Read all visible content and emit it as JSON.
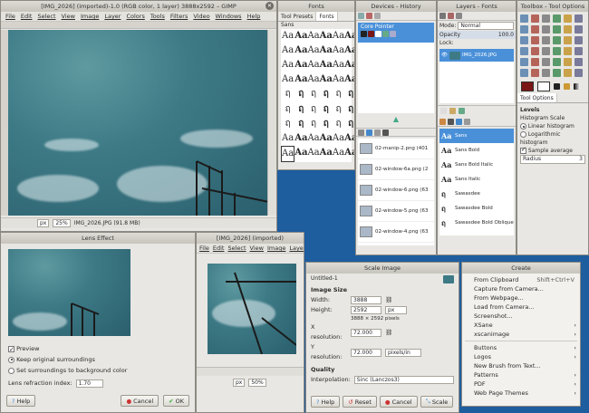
{
  "gimp": {
    "title": "[IMG_2026] (imported)-1.0 (RGB color, 1 layer) 3888x2592 – GIMP",
    "menu": [
      "File",
      "Edit",
      "Select",
      "View",
      "Image",
      "Layer",
      "Colors",
      "Tools",
      "Filters",
      "Video",
      "Windows",
      "Help"
    ],
    "status_unit": "px",
    "zoom": "25%",
    "filename": "IMG_2026.JPG (91.8 MB)"
  },
  "fonts_dock": {
    "title": "Fonts",
    "tabs": [
      "Tool Presets",
      "Fonts"
    ],
    "header": "Sans",
    "glyph_rows": [
      [
        "Aa",
        "Aa",
        "Aa",
        "Aa",
        "Aa",
        "Aa"
      ],
      [
        "Aa",
        "Aa",
        "Aa",
        "Aa",
        "Aa",
        "Aa"
      ],
      [
        "Aa",
        "Aa",
        "Aa",
        "Aa",
        "Aa",
        "Aa"
      ],
      [
        "Aa",
        "Aa",
        "Aa",
        "Aa",
        "Aa",
        "Aa"
      ],
      [
        "ฤ",
        "ฤ",
        "ฤ",
        "ฤ",
        "ฤ",
        "ฤ"
      ],
      [
        "ฤ",
        "ฤ",
        "ฤ",
        "ฤ",
        "ฤ",
        "ฤ"
      ],
      [
        "ฤ",
        "ฤ",
        "ฤ",
        "ฤ",
        "ฤ",
        "ฤ"
      ],
      [
        "Aa",
        "Aa",
        "Aa",
        "Aa",
        "Aa",
        "Aa"
      ],
      [
        "Aa",
        "Aa",
        "Aa",
        "Aa",
        "Aa",
        "Aa"
      ]
    ]
  },
  "devices_dock": {
    "title": "Devices - History",
    "device": "Core Pointer",
    "history": [
      "02-manip-2.png (401",
      "02-window-6a.png (2",
      "02-window-6.png (63",
      "02-window-5.png (63",
      "02-window-4.png (63"
    ]
  },
  "layers_dock": {
    "title": "Layers - Fonts",
    "mode_label": "Mode:",
    "mode_value": "Normal",
    "opacity_label": "Opacity",
    "opacity_value": "100.0",
    "lock_label": "Lock:",
    "layer_name": "IMG_2026.JPG",
    "fonts": [
      "Sans",
      "Sans Bold",
      "Sans Bold Italic",
      "Sans Italic",
      "Sawasdee",
      "Sawasdee Bold",
      "Sawasdee Bold Oblique"
    ]
  },
  "toolbox": {
    "title": "Toolbox - Tool Options",
    "tab": "Tool Options",
    "levels_label": "Levels",
    "histogram_label": "Histogram Scale",
    "linear": "Linear histogram",
    "log": "Logarithmic histogram",
    "sample_average": "Sample average",
    "radius_label": "Radius",
    "radius_value": "3",
    "colors": {
      "fg": "#7a1616",
      "bg": "#ffffff"
    }
  },
  "lens": {
    "title": "Lens Effect",
    "preview": "Preview",
    "keep": "Keep original surroundings",
    "set_bg": "Set surroundings to background color",
    "refraction_label": "Lens refraction index:",
    "refraction_value": "1.70",
    "help": "Help",
    "cancel": "Cancel",
    "ok": "OK"
  },
  "gimp2": {
    "title": "[IMG_2026] (imported)",
    "menu": [
      "File",
      "Edit",
      "Select",
      "View",
      "Image",
      "Layer"
    ],
    "unit": "px",
    "zoom": "50%"
  },
  "scale": {
    "title": "Scale Image",
    "subtitle": "Untitled-1",
    "image_size": "Image Size",
    "width_label": "Width:",
    "width_value": "3888",
    "height_label": "Height:",
    "height_value": "2592",
    "pixels_info": "3888 × 2592 pixels",
    "unit": "px",
    "xres_label": "X resolution:",
    "xres_value": "72.000",
    "yres_label": "Y resolution:",
    "yres_value": "72.000",
    "res_unit": "pixels/in",
    "quality": "Quality",
    "interp_label": "Interpolation:",
    "interp_value": "Sinc (Lanczos3)",
    "help": "Help",
    "reset": "Reset",
    "cancel": "Cancel",
    "scale": "Scale"
  },
  "create": {
    "title": "Create",
    "items": [
      {
        "label": "From Clipboard",
        "acc": "Shift+Ctrl+V"
      },
      {
        "label": "Capture from Camera...",
        "acc": ""
      },
      {
        "label": "From Webpage...",
        "acc": ""
      },
      {
        "label": "Load from Camera...",
        "acc": ""
      },
      {
        "label": "Screenshot...",
        "acc": ""
      },
      {
        "label": "XSane",
        "acc": "›"
      },
      {
        "label": "xscanimage",
        "acc": "›"
      }
    ],
    "items2": [
      {
        "label": "Buttons",
        "acc": "›"
      },
      {
        "label": "Logos",
        "acc": "›"
      },
      {
        "label": "New Brush from Text...",
        "acc": ""
      },
      {
        "label": "Patterns",
        "acc": "›"
      },
      {
        "label": "PDF",
        "acc": "›"
      },
      {
        "label": "Web Page Themes",
        "acc": "›"
      }
    ]
  }
}
